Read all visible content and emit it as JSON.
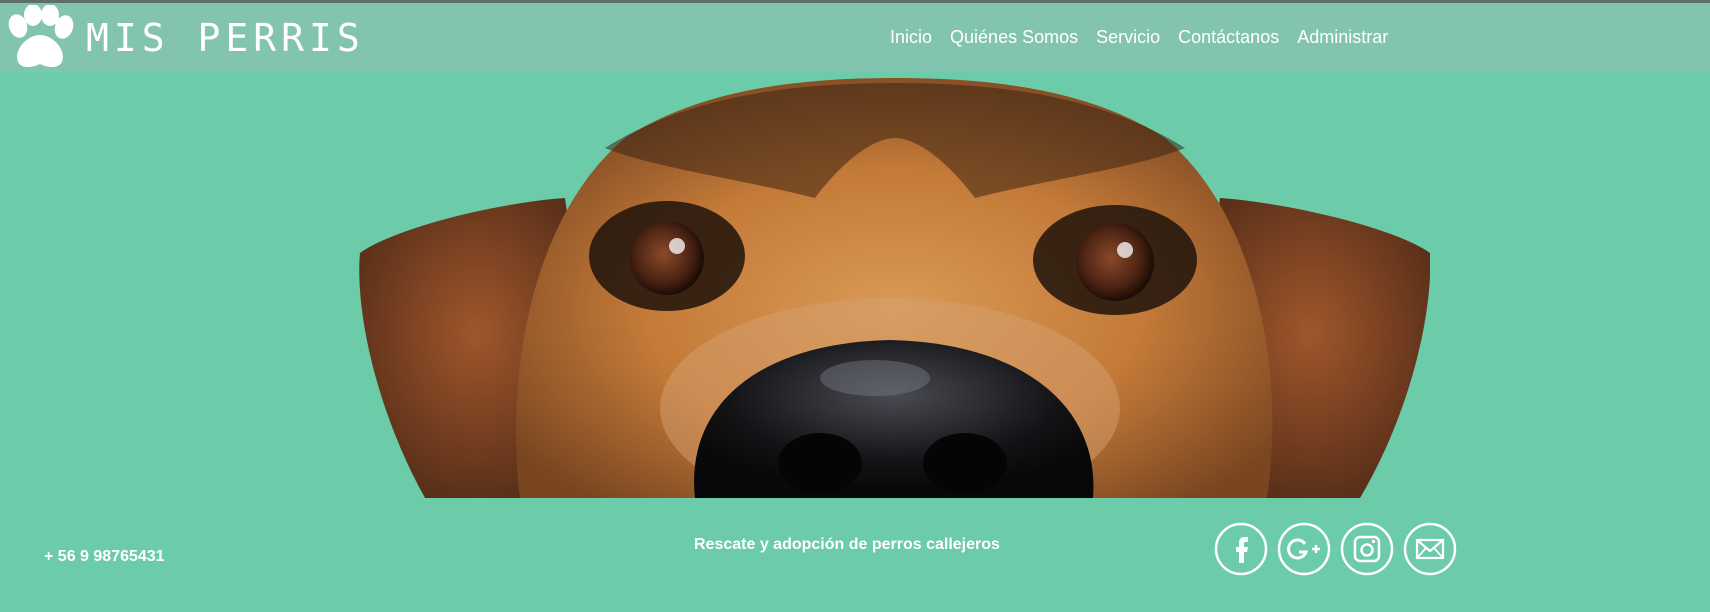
{
  "brand": {
    "logo_icon": "paw-icon",
    "name": "MIS PERRIS"
  },
  "nav": {
    "items": [
      {
        "label": "Inicio"
      },
      {
        "label": "Quiénes Somos"
      },
      {
        "label": "Servicio"
      },
      {
        "label": "Contáctanos"
      },
      {
        "label": "Administrar"
      }
    ]
  },
  "hero": {
    "image": "dog-face-photo"
  },
  "footer": {
    "phone": "+ 56 9 98765431",
    "tagline": "Rescate y adopción de perros callejeros",
    "social": [
      {
        "icon": "facebook-icon"
      },
      {
        "icon": "google-plus-icon"
      },
      {
        "icon": "instagram-icon"
      },
      {
        "icon": "mail-icon"
      }
    ]
  },
  "colors": {
    "background": "#6ccba9",
    "navbar": "#82c4b0",
    "text": "#ffffff"
  }
}
